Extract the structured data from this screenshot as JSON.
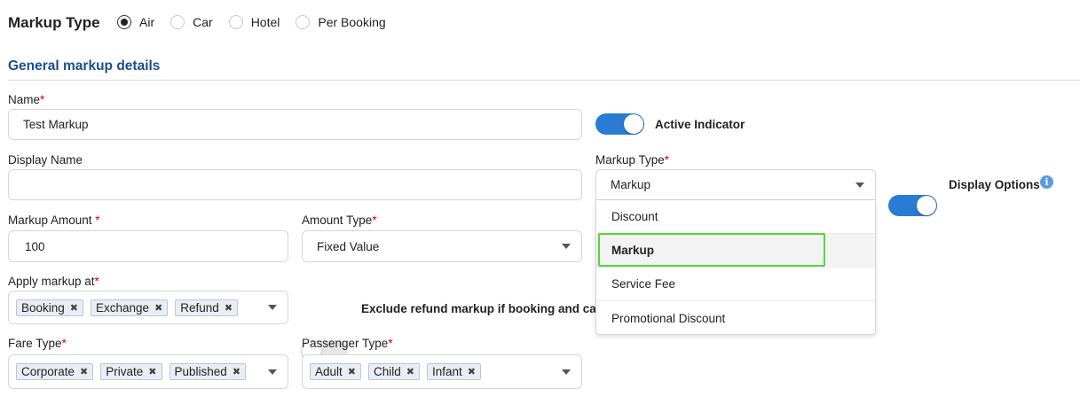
{
  "header": {
    "title": "Markup Type",
    "radio_options": [
      {
        "label": "Air",
        "checked": true
      },
      {
        "label": "Car",
        "checked": false
      },
      {
        "label": "Hotel",
        "checked": false
      },
      {
        "label": "Per Booking",
        "checked": false
      }
    ]
  },
  "section": {
    "title": "General markup details"
  },
  "form": {
    "name": {
      "label": "Name",
      "required_mark": "*",
      "value": "Test Markup"
    },
    "active_indicator": {
      "label": "Active Indicator",
      "on": true
    },
    "display_name": {
      "label": "Display Name",
      "value": ""
    },
    "markup_type": {
      "label": "Markup Type",
      "required_mark": "*",
      "value": "Markup"
    },
    "display_options": {
      "label": "Display Options",
      "on": true,
      "info_icon": "i"
    },
    "markup_amount": {
      "label": "Markup Amount ",
      "required_mark": "*",
      "value": "100"
    },
    "amount_type": {
      "label": "Amount Type",
      "required_mark": "*",
      "value": "Fixed Value"
    },
    "apply_markup_at": {
      "label": "Apply markup at",
      "required_mark": "*",
      "tags": [
        "Booking",
        "Exchange",
        "Refund"
      ]
    },
    "exclude_refund": {
      "label": "Exclude refund markup if booking and can",
      "on": false
    },
    "fare_type": {
      "label": "Fare Type",
      "required_mark": "*",
      "tags": [
        "Corporate",
        "Private",
        "Published"
      ]
    },
    "passenger_type": {
      "label": "Passenger Type",
      "required_mark": "*",
      "tags": [
        "Adult",
        "Child",
        "Infant"
      ]
    },
    "tag_remove_glyph": "✖"
  },
  "dropdown": {
    "options": [
      "Discount",
      "Markup",
      "Service Fee",
      "Promotional Discount"
    ],
    "highlighted_index": 1
  },
  "colors": {
    "section_title": "#1b4f8f",
    "toggle_on": "#2a7bd3",
    "required": "#d0021b",
    "highlight_border": "#55d63a"
  }
}
